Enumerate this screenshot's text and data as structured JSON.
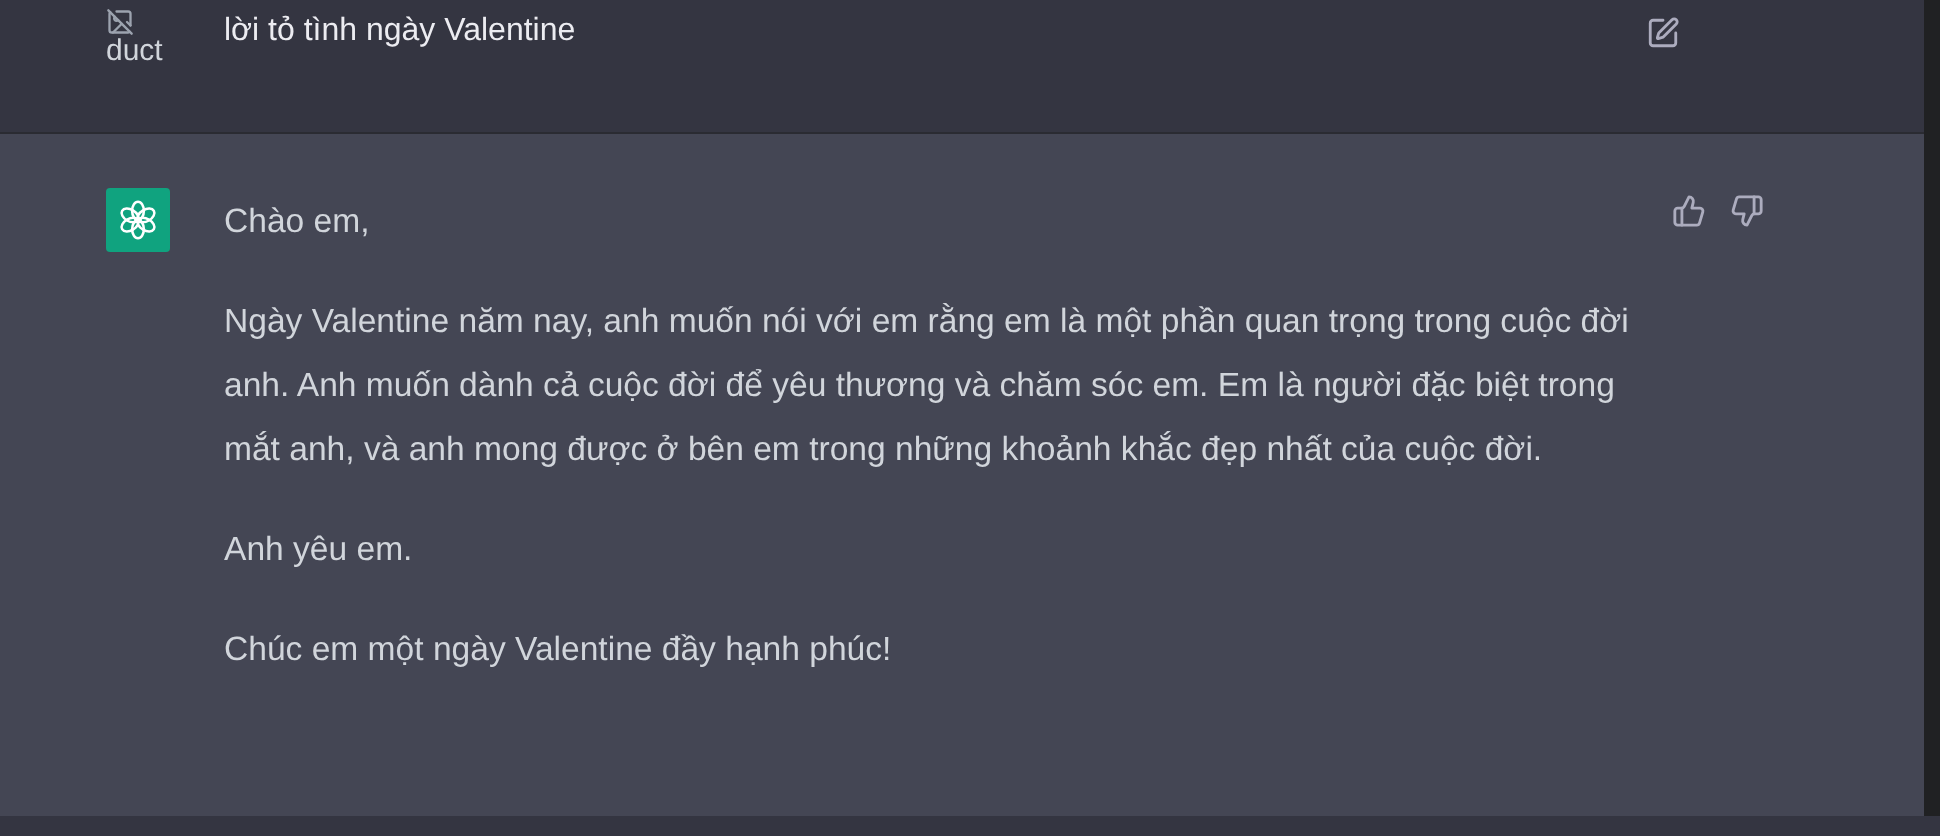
{
  "prompt": {
    "image_alt": "duct",
    "text": "lời tỏ tình ngày Valentine"
  },
  "response": {
    "paragraphs": [
      "Chào em,",
      "Ngày Valentine năm nay, anh muốn nói với em rằng em là một phần quan trọng trong cuộc đời anh. Anh muốn dành cả cuộc đời để yêu thương và chăm sóc em. Em là người đặc biệt trong mắt anh, và anh mong được ở bên em trong những khoảnh khắc đẹp nhất của cuộc đời.",
      "Anh yêu em.",
      "Chúc em một ngày Valentine đầy hạnh phúc!"
    ]
  }
}
